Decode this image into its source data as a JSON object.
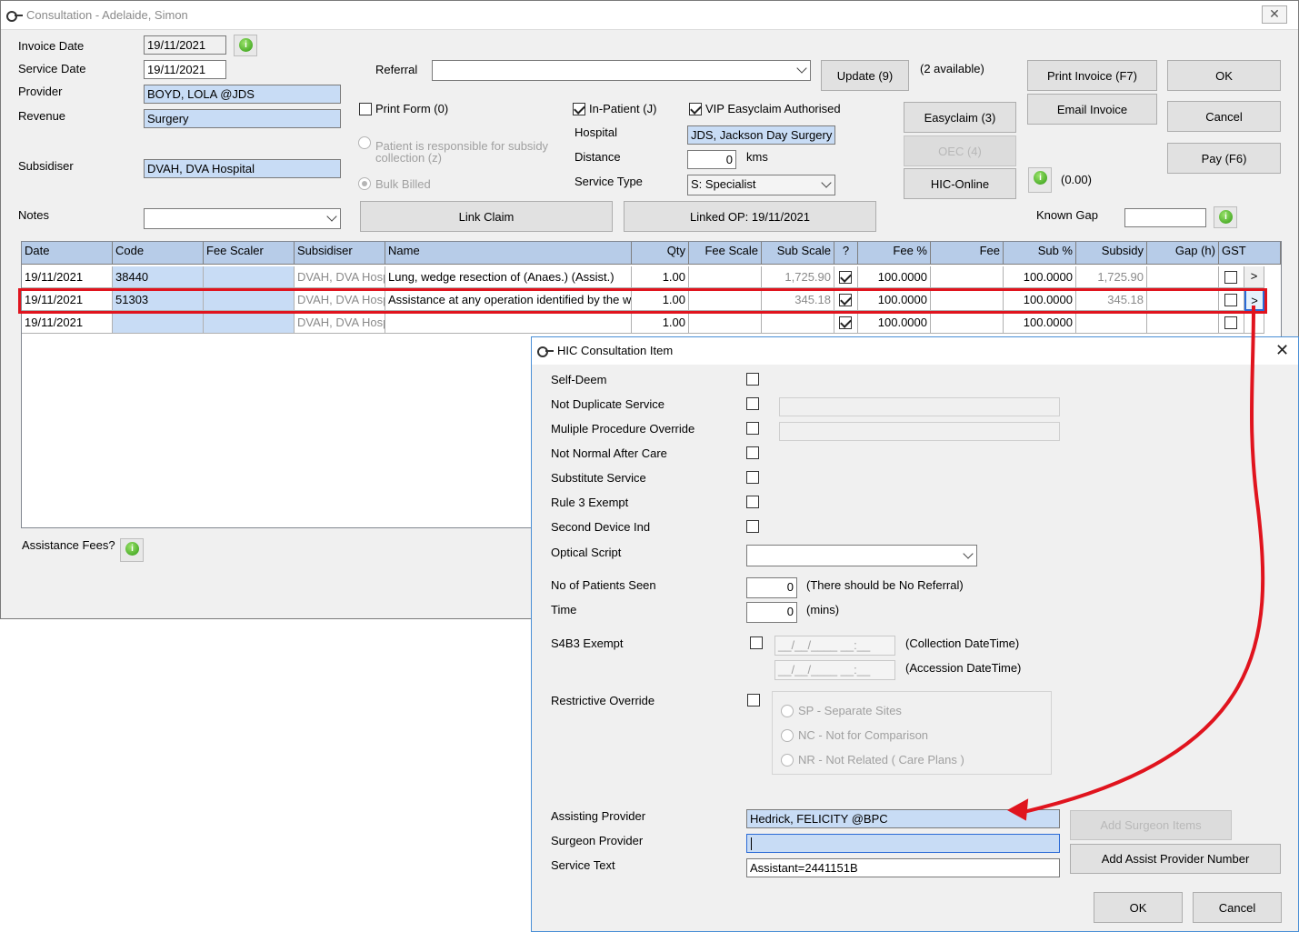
{
  "main": {
    "title": "Consultation - Adelaide, Simon",
    "close_glyph": "✕",
    "labels": {
      "invoice_date": "Invoice Date",
      "service_date": "Service Date",
      "provider": "Provider",
      "revenue": "Revenue",
      "subsidiser": "Subsidiser",
      "notes": "Notes",
      "referral": "Referral",
      "hospital": "Hospital",
      "distance": "Distance",
      "service_type": "Service Type",
      "kms": "kms",
      "known_gap": "Known Gap",
      "assistance_fees": "Assistance Fees?",
      "available": "(2 available)",
      "pay_amount": "(0.00)"
    },
    "values": {
      "invoice_date": "19/11/2021",
      "service_date": "19/11/2021",
      "provider": "BOYD, LOLA @JDS",
      "revenue": "Surgery",
      "subsidiser": "DVAH, DVA Hospital",
      "notes": "",
      "referral": "",
      "hospital": "JDS, Jackson Day Surgery",
      "distance": "0",
      "service_type": "S: Specialist",
      "known_gap": ""
    },
    "checks": {
      "print_form": "Print Form (0)",
      "in_patient": "In-Patient (J)",
      "vip": "VIP Easyclaim Authorised"
    },
    "radios": {
      "patient_responsible": "Patient is responsible for subsidy collection (z)",
      "bulk_billed": "Bulk Billed"
    },
    "buttons": {
      "update": "Update (9)",
      "print_invoice": "Print Invoice (F7)",
      "ok": "OK",
      "easyclaim": "Easyclaim (3)",
      "email_invoice": "Email Invoice",
      "cancel": "Cancel",
      "oec": "OEC (4)",
      "pay": "Pay (F6)",
      "hic_online": "HIC-Online",
      "link_claim": "Link Claim",
      "linked_op": "Linked OP: 19/11/2021"
    }
  },
  "grid": {
    "headers": [
      "Date",
      "Code",
      "Fee Scaler",
      "Subsidiser",
      "Name",
      "Qty",
      "Fee Scale",
      "Sub Scale",
      "?",
      "Fee %",
      "Fee",
      "Sub %",
      "Subsidy",
      "Gap (h)",
      "GST"
    ],
    "rows": [
      {
        "date": "19/11/2021",
        "code": "38440",
        "fee_scaler": "",
        "subsidiser": "DVAH, DVA Hosp",
        "name": "Lung, wedge resection of (Anaes.) (Assist.)",
        "qty": "1.00",
        "fee_scale": "",
        "sub_scale": "1,725.90",
        "check": true,
        "fee_pct": "100.0000",
        "fee": "",
        "sub_pct": "100.0000",
        "subsidy": "1,725.90",
        "gap": "",
        "gst": false,
        "more": ">"
      },
      {
        "date": "19/11/2021",
        "code": "51303",
        "fee_scaler": "",
        "subsidiser": "DVAH, DVA Hosp",
        "name": "Assistance at any operation identified by the word",
        "qty": "1.00",
        "fee_scale": "",
        "sub_scale": "345.18",
        "check": true,
        "fee_pct": "100.0000",
        "fee": "",
        "sub_pct": "100.0000",
        "subsidy": "345.18",
        "gap": "",
        "gst": false,
        "more": ">"
      },
      {
        "date": "19/11/2021",
        "code": "",
        "fee_scaler": "",
        "subsidiser": "DVAH, DVA Hosp",
        "name": "",
        "qty": "1.00",
        "fee_scale": "",
        "sub_scale": "",
        "check": true,
        "fee_pct": "100.0000",
        "fee": "",
        "sub_pct": "100.0000",
        "subsidy": "",
        "gap": "",
        "gst": false,
        "more": ""
      }
    ]
  },
  "dialog": {
    "title": "HIC Consultation Item",
    "close_glyph": "✕",
    "labels": {
      "self_deem": "Self-Deem",
      "not_duplicate": "Not Duplicate Service",
      "multiple_override": "Muliple Procedure Override",
      "not_normal": "Not Normal After Care",
      "substitute": "Substitute Service",
      "rule3": "Rule 3 Exempt",
      "second_device": "Second Device Ind",
      "optical_script": "Optical Script",
      "patients_seen": "No of Patients Seen",
      "time": "Time",
      "s4b3": "S4B3 Exempt",
      "restrictive": "Restrictive Override",
      "assisting": "Assisting Provider",
      "surgeon": "Surgeon Provider",
      "service_text": "Service Text"
    },
    "notes": {
      "no_referral": "(There should be No Referral)",
      "mins": "(mins)",
      "collection": "(Collection DateTime)",
      "accession": "(Accession DateTime)"
    },
    "values": {
      "patients_seen": "0",
      "time": "0",
      "collection_mask": "__/__/____ __:__",
      "accession_mask": "__/__/____ __:__",
      "assisting": "Hedrick, FELICITY @BPC",
      "surgeon": "",
      "service_text": "Assistant=2441151B"
    },
    "radios": {
      "sp": "SP - Separate Sites",
      "nc": "NC - Not for Comparison",
      "nr": "NR - Not Related ( Care Plans )"
    },
    "buttons": {
      "add_surgeon": "Add Surgeon Items",
      "add_assist": "Add Assist Provider Number",
      "ok": "OK",
      "cancel": "Cancel"
    }
  },
  "colors": {
    "highlight_red": "#e0141e",
    "field_blue": "#c8dcf5",
    "header_blue": "#b7cce8"
  }
}
